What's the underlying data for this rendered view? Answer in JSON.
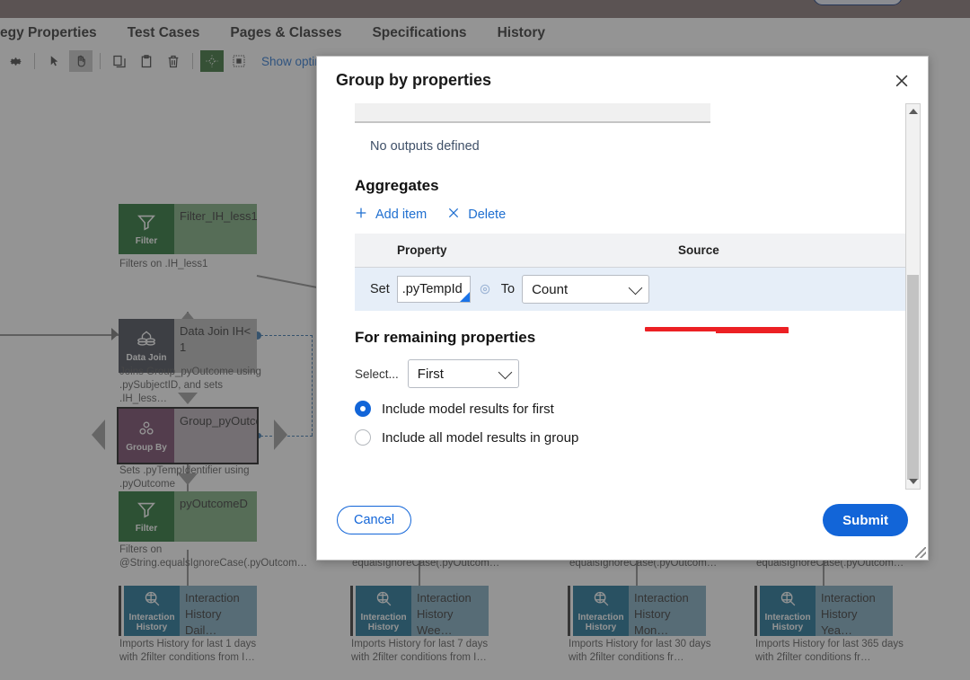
{
  "app": {
    "tabs": [
      {
        "label": "egy Properties"
      },
      {
        "label": "Test Cases"
      },
      {
        "label": "Pages & Classes"
      },
      {
        "label": "Specifications"
      },
      {
        "label": "History"
      }
    ],
    "toolbar": {
      "icons": [
        {
          "name": "gear-icon",
          "glyph": "⚙"
        },
        {
          "name": "pointer-icon",
          "glyph": "➤"
        },
        {
          "name": "pan-hand-icon",
          "glyph": "✋"
        },
        {
          "name": "copy-icon",
          "glyph": "❐"
        },
        {
          "name": "paste-icon",
          "glyph": "ὌB"
        },
        {
          "name": "delete-trash-icon",
          "glyph": "Ὕ1"
        },
        {
          "name": "align-center-icon",
          "glyph": "⌖"
        },
        {
          "name": "fit-to-screen-icon",
          "glyph": "⬚"
        }
      ],
      "show_optimization_label": "Show optimization"
    }
  },
  "canvas": {
    "nodes": [
      {
        "id": "filter-ih-less1",
        "type": "Filter",
        "icon": "filter-funnel-icon",
        "title": "Filter_IH_less1",
        "caption": "Filters on .IH_less1"
      },
      {
        "id": "data-join-ih",
        "type": "Data Join",
        "icon": "data-join-icon",
        "title": "Data Join IH< 1",
        "caption": "Joins Group_pyOutcome using .pySubjectID, and sets .IH_less…"
      },
      {
        "id": "group-pyoutcome",
        "type": "Group By",
        "icon": "group-by-icon",
        "title": "Group_pyOutcome",
        "caption": "Sets .pyTempIdentifier using .pyOutcome"
      },
      {
        "id": "filter-pyoutcomed",
        "type": "Filter",
        "icon": "filter-funnel-icon",
        "title": "pyOutcomeD",
        "caption": "Filters on @String.equalsIgnoreCase(.pyOutcom…"
      },
      {
        "id": "ih-daily",
        "type": "Interaction History",
        "icon": "interaction-history-icon",
        "title": "Interaction History Dail…",
        "caption": "Imports History for last 1 days with 2filter conditions from I…"
      },
      {
        "id": "ih-weekly",
        "type": "Interaction History",
        "icon": "interaction-history-icon",
        "title": "Interaction History Wee…",
        "caption": "Imports History for last 7 days with 2filter conditions from I…"
      },
      {
        "id": "ih-monthly",
        "type": "Interaction History",
        "icon": "interaction-history-icon",
        "title": "Interaction History Mon…",
        "caption": "Imports History for last 30 days with 2filter conditions fr…"
      },
      {
        "id": "ih-yearly",
        "type": "Interaction History",
        "icon": "interaction-history-icon",
        "title": "Interaction History Yea…",
        "caption": "Imports History for last 365 days with 2filter conditions fr…"
      }
    ],
    "orphan_captions": [
      "equalsIgnoreCase(.pyOutcom…",
      "equalsIgnoreCase(.pyOutcom…",
      "equalsIgnoreCase(.pyOutcom…"
    ]
  },
  "modal": {
    "title": "Group by properties",
    "close_icon": "close-icon",
    "outputs": {
      "field_value": "",
      "empty_message": "No outputs defined"
    },
    "aggregates": {
      "heading": "Aggregates",
      "add_item_label": "Add item",
      "add_item_icon": "plus-icon",
      "delete_label": "Delete",
      "delete_icon": "x-icon",
      "columns": [
        "Property",
        "Source"
      ],
      "rows": [
        {
          "set_label": "Set",
          "property_value": ".pyTempId",
          "target_icon": "crosshair-icon",
          "to_label": "To",
          "source_value": "Count"
        }
      ]
    },
    "remaining": {
      "heading": "For remaining properties",
      "select_label": "Select...",
      "select_value": "First",
      "options": [
        {
          "label": "Include model results for first",
          "selected": true
        },
        {
          "label": "Include all model results in group",
          "selected": false
        }
      ]
    },
    "footer": {
      "cancel_label": "Cancel",
      "submit_label": "Submit"
    },
    "scrollbar": {
      "up_icon": "scroll-up-icon",
      "down_icon": "scroll-down-icon"
    }
  },
  "annotation": {
    "highlight_color": "#ec2024"
  }
}
